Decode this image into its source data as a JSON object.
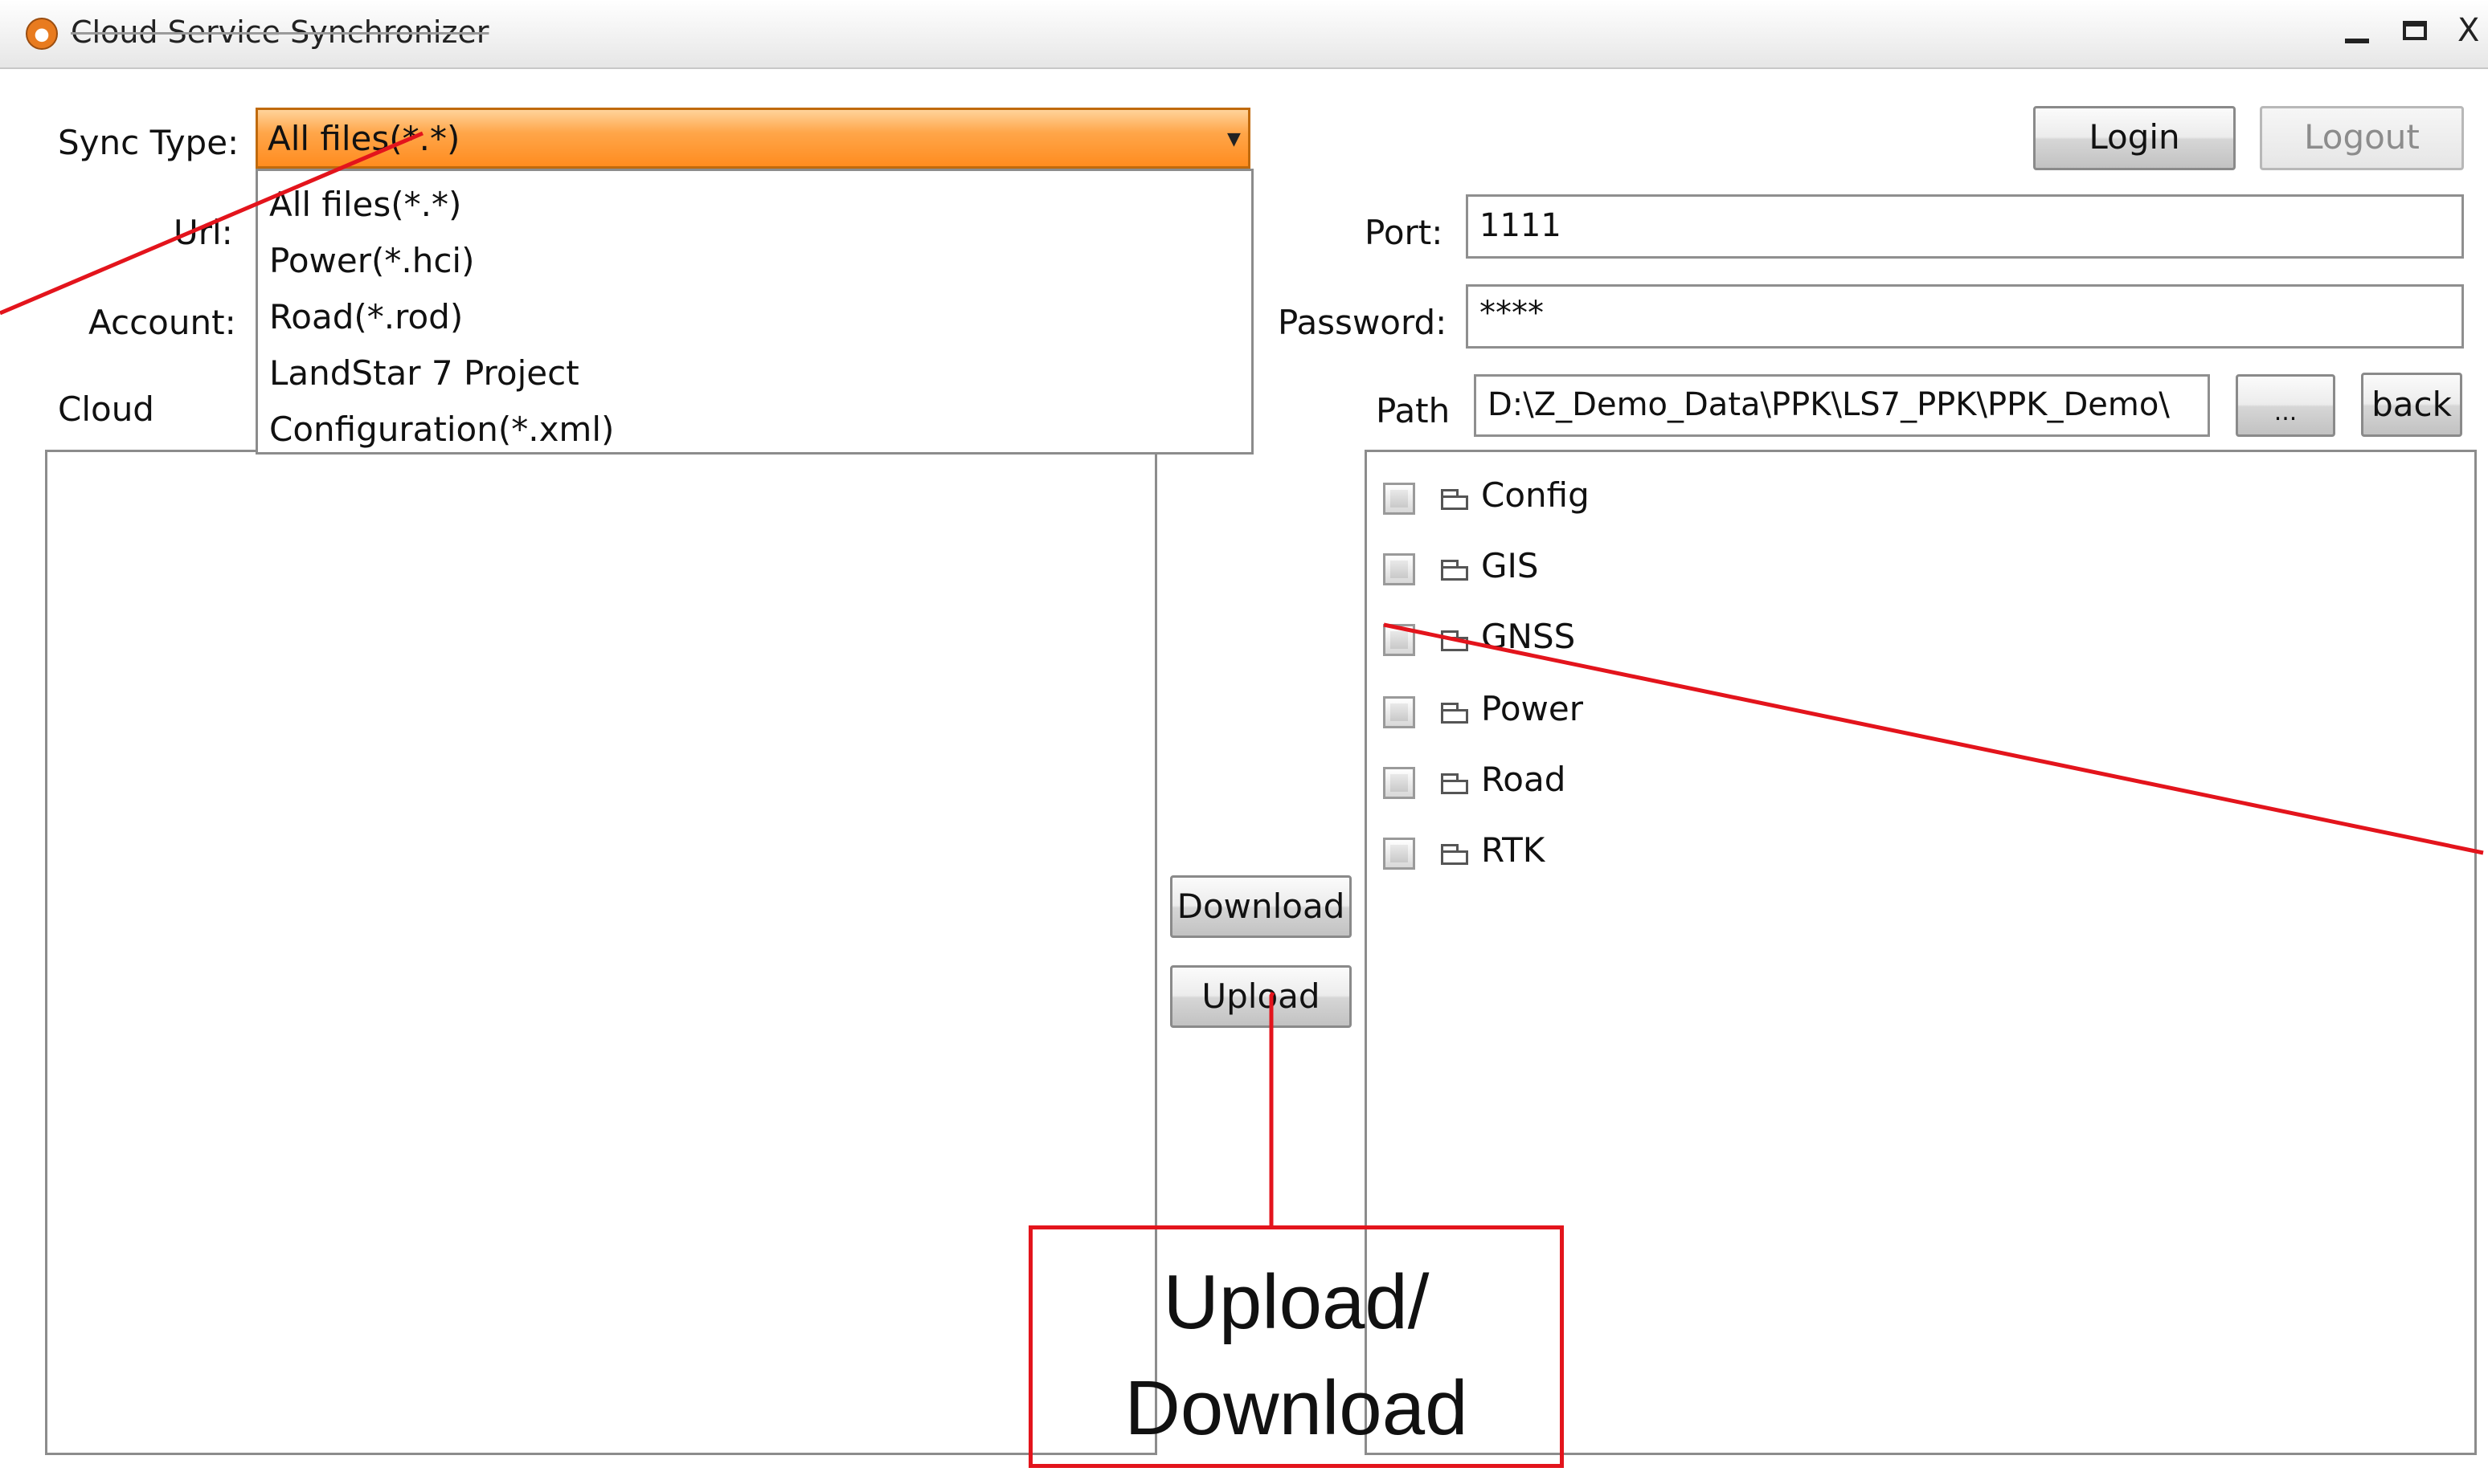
{
  "window": {
    "title": "Cloud Service Synchronizer",
    "controls": {
      "minimize": "—",
      "maximize": "",
      "close": "X"
    }
  },
  "labels": {
    "sync_type": "Sync Type:",
    "url": "Url:",
    "account": "Account:",
    "cloud": "Cloud",
    "port": "Port:",
    "password": "Password:",
    "path": "Path"
  },
  "sync_type": {
    "selected": "All files(*.*)",
    "options": [
      "All files(*.*)",
      "Power(*.hci)",
      "Road(*.rod)",
      "LandStar 7 Project",
      "Configuration(*.xml)"
    ]
  },
  "buttons": {
    "login": "Login",
    "logout": "Logout",
    "browse": "...",
    "back": "back",
    "download": "Download",
    "upload": "Upload"
  },
  "fields": {
    "port": "1111",
    "password": "****",
    "path": "D:\\Z_Demo_Data\\PPK\\LS7_PPK\\PPK_Demo\\"
  },
  "local_tree": {
    "items": [
      {
        "label": "Config",
        "checked": false,
        "icon": "folder-icon"
      },
      {
        "label": "GIS",
        "checked": false,
        "icon": "folder-icon"
      },
      {
        "label": "GNSS",
        "checked": false,
        "icon": "folder-icon"
      },
      {
        "label": "Power",
        "checked": false,
        "icon": "folder-icon"
      },
      {
        "label": "Road",
        "checked": false,
        "icon": "folder-icon"
      },
      {
        "label": "RTK",
        "checked": false,
        "icon": "folder-icon"
      }
    ]
  },
  "annotations": {
    "callout_line1": "Upload/",
    "callout_line2": "Download",
    "color": "#e3141c"
  },
  "colors": {
    "combo_accent": "#ff8c1f",
    "annotation": "#e3141c"
  }
}
